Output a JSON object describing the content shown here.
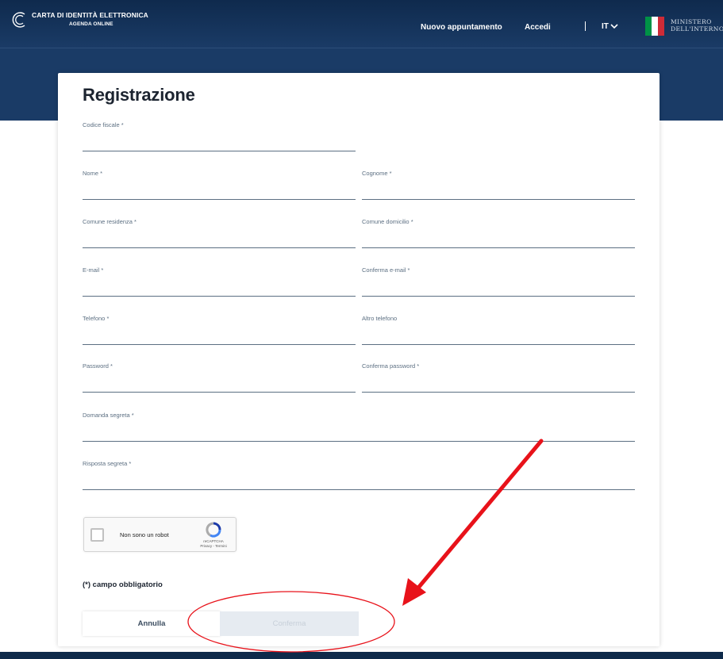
{
  "header": {
    "brand_line1": "CARTA DI IDENTITÀ ELETTRONICA",
    "brand_line2": "AGENDA ONLINE",
    "nav_new_appointment": "Nuovo appuntamento",
    "nav_login": "Accedi",
    "language": "IT",
    "ministry_line1": "MINISTERO",
    "ministry_line2": "DELL'INTERNO"
  },
  "form": {
    "title": "Registrazione",
    "fields": {
      "codice_fiscale": "Codice fiscale *",
      "nome": "Nome *",
      "cognome": "Cognome *",
      "comune_residenza": "Comune residenza *",
      "comune_domicilio": "Comune domicilio *",
      "email": "E-mail *",
      "conferma_email": "Conferma e-mail *",
      "telefono": "Telefono *",
      "altro_telefono": "Altro telefono",
      "password": "Password *",
      "conferma_password": "Conferma password *",
      "domanda_segreta": "Domanda segreta *",
      "risposta_segreta": "Risposta segreta *"
    },
    "captcha": {
      "label": "Non sono un robot",
      "brand": "reCAPTCHA",
      "links": "Privacy - Termini"
    },
    "required_note": "(*) campo obbligatorio",
    "buttons": {
      "cancel": "Annulla",
      "confirm": "Conferma"
    }
  },
  "colors": {
    "header_bg": "#1a3b66",
    "annotation": "#e8121a"
  }
}
